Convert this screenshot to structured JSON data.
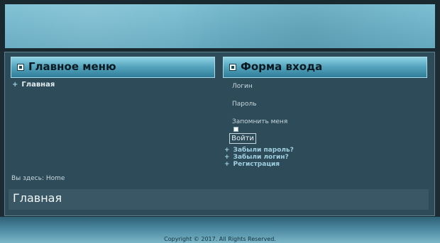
{
  "menu": {
    "title": "Главное меню",
    "items": [
      {
        "label": "Главная"
      }
    ]
  },
  "login_form": {
    "title": "Форма входа",
    "login_label": "Логин",
    "password_label": "Пароль",
    "remember_label": "Запомнить меня",
    "submit_label": "Войти",
    "links": [
      {
        "label": "Забыли пароль?"
      },
      {
        "label": "Забыли логин?"
      },
      {
        "label": "Регистрация"
      }
    ]
  },
  "breadcrumb": {
    "prefix": "Вы здесь:",
    "current": "Home"
  },
  "article": {
    "title": "Главная"
  },
  "footer": {
    "copyright": "Copyright © 2017. All Rights Reserved."
  }
}
